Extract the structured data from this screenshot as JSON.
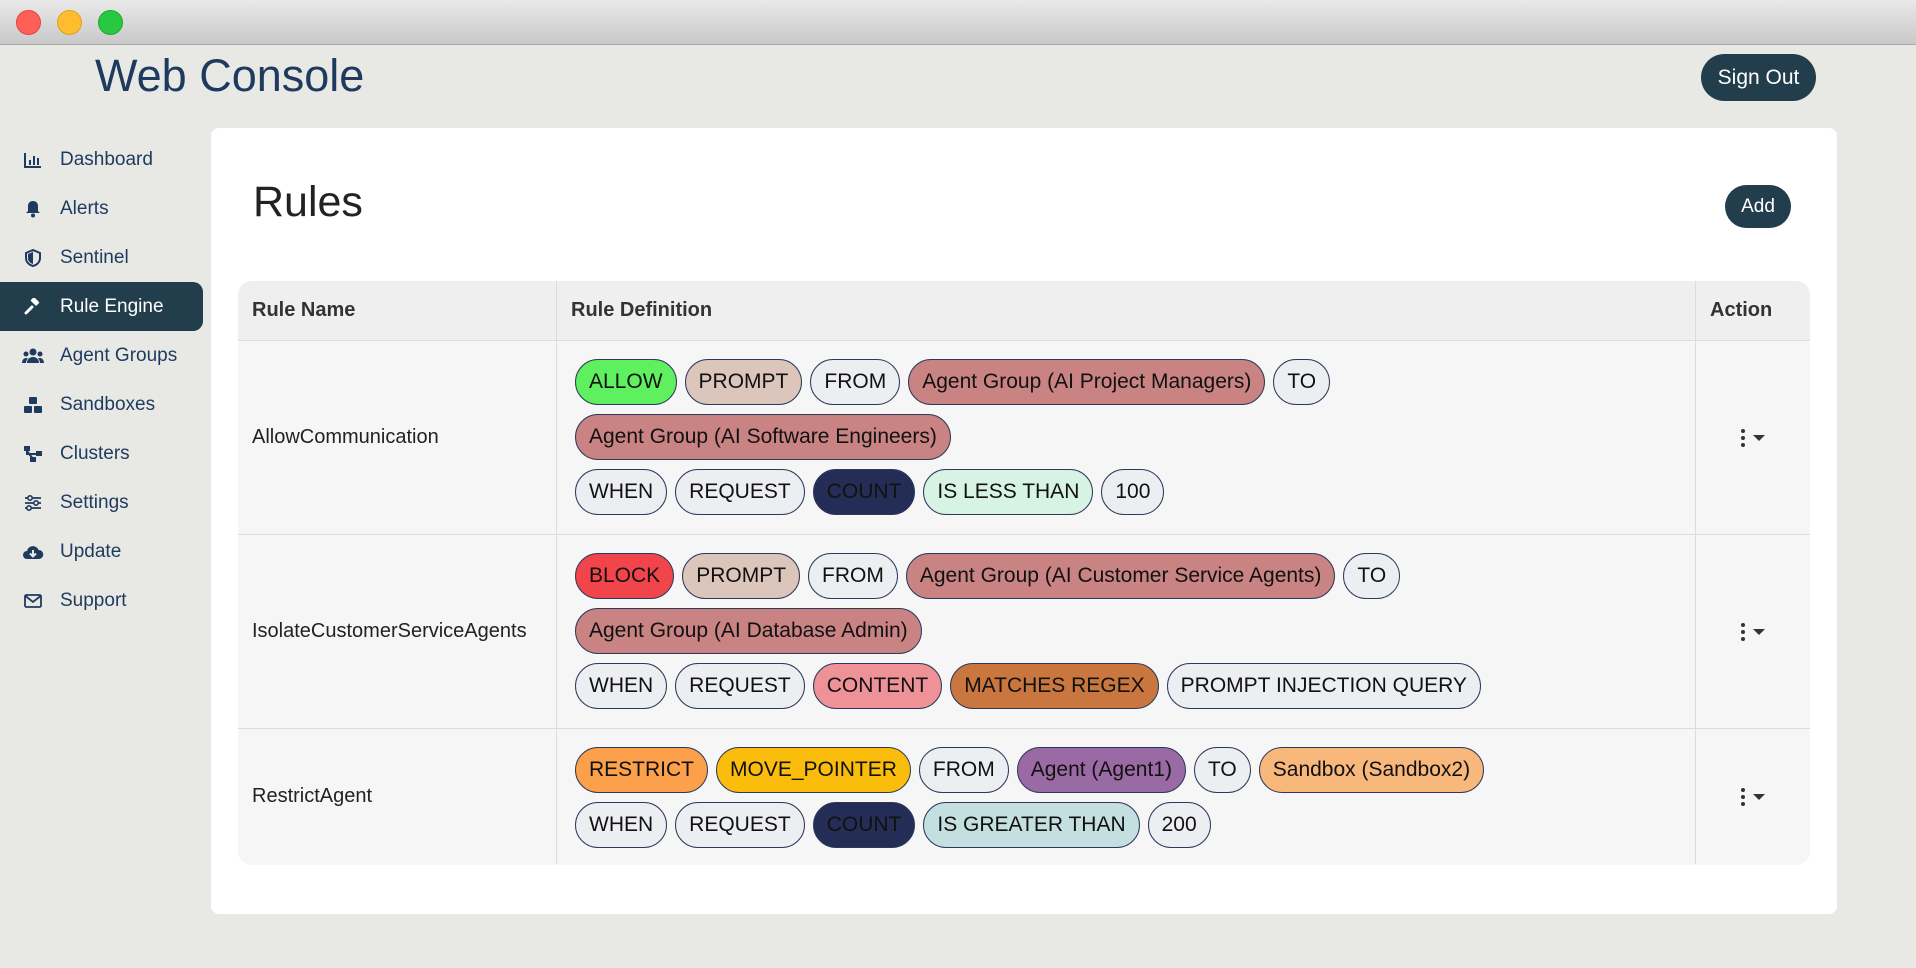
{
  "app": {
    "title": "Web Console",
    "sign_out_label": "Sign Out"
  },
  "sidebar": {
    "items": [
      {
        "label": "Dashboard",
        "icon": "chart-icon",
        "active": false
      },
      {
        "label": "Alerts",
        "icon": "bell-icon",
        "active": false
      },
      {
        "label": "Sentinel",
        "icon": "shield-icon",
        "active": false
      },
      {
        "label": "Rule Engine",
        "icon": "gavel-icon",
        "active": true
      },
      {
        "label": "Agent Groups",
        "icon": "users-icon",
        "active": false
      },
      {
        "label": "Sandboxes",
        "icon": "cubes-icon",
        "active": false
      },
      {
        "label": "Clusters",
        "icon": "network-icon",
        "active": false
      },
      {
        "label": "Settings",
        "icon": "sliders-icon",
        "active": false
      },
      {
        "label": "Update",
        "icon": "cloud-download-icon",
        "active": false
      },
      {
        "label": "Support",
        "icon": "envelope-icon",
        "active": false
      }
    ]
  },
  "main": {
    "title": "Rules",
    "add_label": "Add",
    "columns": [
      "Rule Name",
      "Rule Definition",
      "Action"
    ],
    "rules": [
      {
        "name": "AllowCommunication",
        "lines": [
          [
            {
              "text": "ALLOW",
              "color": "#5ef05e",
              "fg": "#111111"
            },
            {
              "text": "PROMPT",
              "color": "#dcc5bb",
              "fg": "#111111"
            },
            {
              "text": "FROM",
              "color": "#eceef2",
              "fg": "#111111"
            },
            {
              "text": "Agent Group (AI Project Managers)",
              "color": "#c98383",
              "fg": "#111111"
            },
            {
              "text": "TO",
              "color": "#eceef2",
              "fg": "#111111"
            }
          ],
          [
            {
              "text": "Agent Group (AI Software Engineers)",
              "color": "#c98383",
              "fg": "#111111"
            }
          ],
          [
            {
              "text": "WHEN",
              "color": "#eceef2",
              "fg": "#111111"
            },
            {
              "text": "REQUEST",
              "color": "#eceef2",
              "fg": "#111111"
            },
            {
              "text": "COUNT",
              "color": "#232d55",
              "fg": "#111111"
            },
            {
              "text": "IS LESS THAN",
              "color": "#d6f3e4",
              "fg": "#111111"
            },
            {
              "text": "100",
              "color": "#eceef2",
              "fg": "#111111"
            }
          ]
        ]
      },
      {
        "name": "IsolateCustomerServiceAgents",
        "lines": [
          [
            {
              "text": "BLOCK",
              "color": "#f2454b",
              "fg": "#111111"
            },
            {
              "text": "PROMPT",
              "color": "#dcc5bb",
              "fg": "#111111"
            },
            {
              "text": "FROM",
              "color": "#eceef2",
              "fg": "#111111"
            },
            {
              "text": "Agent Group (AI Customer Service Agents)",
              "color": "#c98383",
              "fg": "#111111"
            },
            {
              "text": "TO",
              "color": "#eceef2",
              "fg": "#111111"
            }
          ],
          [
            {
              "text": "Agent Group (AI Database Admin)",
              "color": "#c98383",
              "fg": "#111111"
            }
          ],
          [
            {
              "text": "WHEN",
              "color": "#eceef2",
              "fg": "#111111"
            },
            {
              "text": "REQUEST",
              "color": "#eceef2",
              "fg": "#111111"
            },
            {
              "text": "CONTENT",
              "color": "#ee9297",
              "fg": "#111111"
            },
            {
              "text": "MATCHES REGEX",
              "color": "#c9773f",
              "fg": "#111111"
            },
            {
              "text": "PROMPT INJECTION QUERY",
              "color": "#eceef2",
              "fg": "#111111"
            }
          ]
        ]
      },
      {
        "name": "RestrictAgent",
        "lines": [
          [
            {
              "text": "RESTRICT",
              "color": "#fca04c",
              "fg": "#111111"
            },
            {
              "text": "MOVE_POINTER",
              "color": "#fbbd0c",
              "fg": "#111111"
            },
            {
              "text": "FROM",
              "color": "#eceef2",
              "fg": "#111111"
            },
            {
              "text": "Agent (Agent1)",
              "color": "#9a6aa4",
              "fg": "#111111"
            },
            {
              "text": "TO",
              "color": "#eceef2",
              "fg": "#111111"
            },
            {
              "text": "Sandbox (Sandbox2)",
              "color": "#f8b77b",
              "fg": "#111111"
            }
          ],
          [
            {
              "text": "WHEN",
              "color": "#eceef2",
              "fg": "#111111"
            },
            {
              "text": "REQUEST",
              "color": "#eceef2",
              "fg": "#111111"
            },
            {
              "text": "COUNT",
              "color": "#232d55",
              "fg": "#111111"
            },
            {
              "text": "IS GREATER THAN",
              "color": "#c4dfe0",
              "fg": "#111111"
            },
            {
              "text": "200",
              "color": "#eceef2",
              "fg": "#111111"
            }
          ]
        ]
      }
    ]
  },
  "colors": {
    "primary": "#223d4b",
    "brand_text": "#1f3a5f",
    "background": "#e8e8e4"
  }
}
